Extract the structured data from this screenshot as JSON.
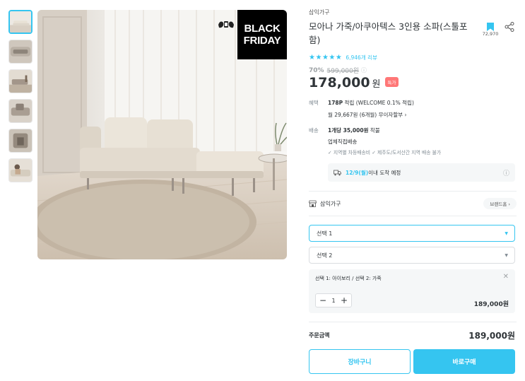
{
  "thumbnails": [
    {
      "name": "thumb-sofa-front",
      "active": true
    },
    {
      "name": "thumb-sofa-detail",
      "active": false
    },
    {
      "name": "thumb-sofa-room",
      "active": false
    },
    {
      "name": "thumb-sofa-side",
      "active": false
    },
    {
      "name": "thumb-sofa-armrest",
      "active": false
    },
    {
      "name": "thumb-sofa-person",
      "active": false
    }
  ],
  "banner": {
    "line1": "BLACK",
    "line2": "FRIDAY"
  },
  "product": {
    "brand": "삼익가구",
    "title": "모아나 가죽/아쿠아텍스 3인용 소파(스툴포함)",
    "bookmark_count": "72,970",
    "rating_stars": 5,
    "review_text": "6,946개 리뷰",
    "discount_rate": "70%",
    "original_price": "599,000원",
    "price": "178,000",
    "won": "원",
    "special_tag": "특가"
  },
  "benefit": {
    "label": "혜택",
    "points": "178P",
    "points_suffix": " 적립 (WELCOME 0.1% 적립)",
    "installment": "월 29,667원 (6개월) 무이자할부 ›"
  },
  "shipping": {
    "label": "배송",
    "fee_bold": "1개당 35,000원",
    "fee_suffix": " 착불",
    "method": "업체직접배송",
    "notes": "✓ 지역별 차등배송비  ✓ 제주도/도서산간 지역 배송 불가",
    "eta_date": "12/9(월)",
    "eta_suffix": " 이내 도착 예정"
  },
  "seller": {
    "name": "삼익가구",
    "brand_home": "브랜드홈 ›"
  },
  "options": {
    "select1": "선택 1",
    "select2": "선택 2",
    "selected_text": "선택 1: 아이보리 / 선택 2: 가죽",
    "quantity": "1",
    "item_price": "189,000원"
  },
  "order": {
    "total_label": "주문금액",
    "total_price": "189,000원"
  },
  "buttons": {
    "cart": "장바구니",
    "buy": "바로구매"
  },
  "colors": {
    "accent": "#35c5f0",
    "tag": "#ff7777",
    "text": "#2f3438"
  }
}
